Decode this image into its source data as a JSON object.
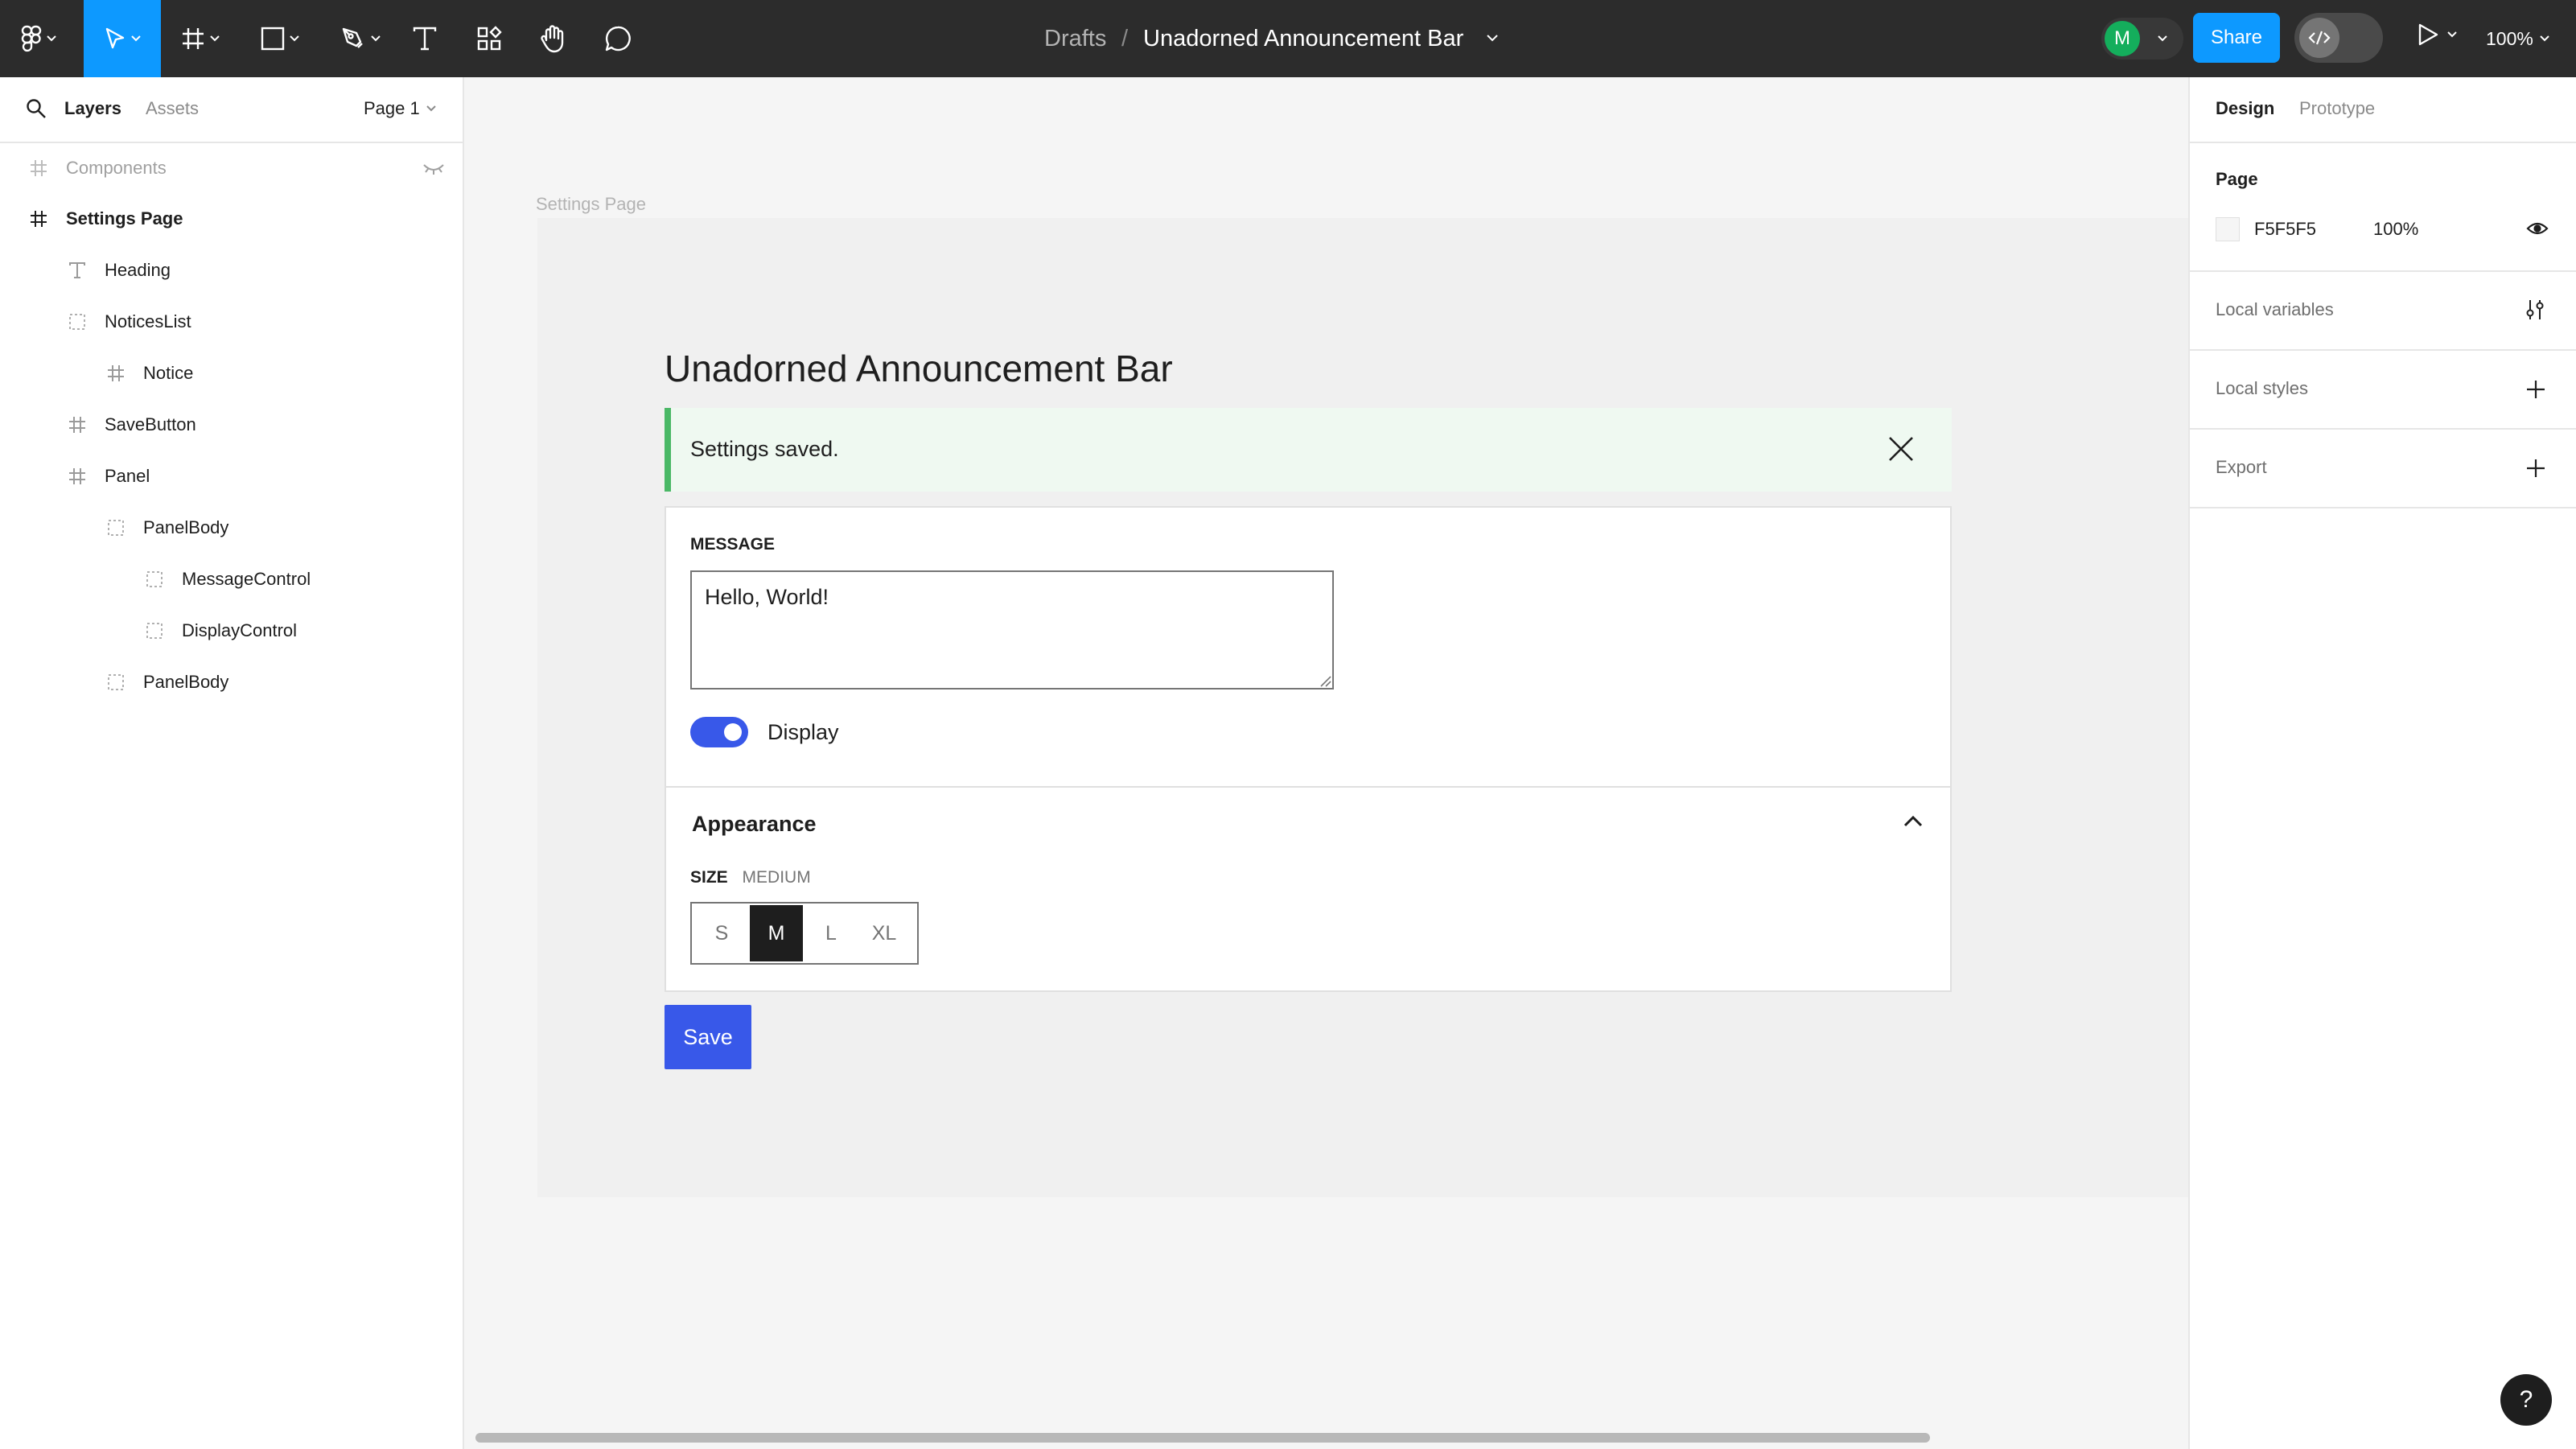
{
  "toolbar": {
    "breadcrumb_parent": "Drafts",
    "breadcrumb_separator": "/",
    "file_name": "Unadorned Announcement Bar",
    "avatar_initial": "M",
    "share_label": "Share",
    "zoom": "100%",
    "tools": [
      "main-menu-icon",
      "move-icon",
      "frame-icon",
      "shape-icon",
      "pen-icon",
      "text-icon",
      "resources-icon",
      "hand-icon",
      "comment-icon"
    ]
  },
  "left_panel": {
    "tab_layers": "Layers",
    "tab_assets": "Assets",
    "page_selector": "Page 1",
    "layers": [
      {
        "label": "Components",
        "icon": "frame-icon",
        "muted": true
      },
      {
        "label": "Settings Page",
        "icon": "frame-icon",
        "bold": true
      },
      {
        "label": "Heading",
        "icon": "text-icon"
      },
      {
        "label": "NoticesList",
        "icon": "group-icon"
      },
      {
        "label": "Notice",
        "icon": "frame-icon"
      },
      {
        "label": "SaveButton",
        "icon": "frame-icon"
      },
      {
        "label": "Panel",
        "icon": "frame-icon"
      },
      {
        "label": "PanelBody",
        "icon": "group-icon"
      },
      {
        "label": "MessageControl",
        "icon": "group-icon"
      },
      {
        "label": "DisplayControl",
        "icon": "group-icon"
      },
      {
        "label": "PanelBody",
        "icon": "group-icon"
      }
    ]
  },
  "right_panel": {
    "tab_design": "Design",
    "tab_prototype": "Prototype",
    "page_heading": "Page",
    "page_color": "F5F5F5",
    "page_opacity": "100%",
    "local_variables": "Local variables",
    "local_styles": "Local styles",
    "export": "Export"
  },
  "canvas": {
    "frame_label": "Settings Page",
    "heading": "Unadorned Announcement Bar",
    "notice_text": "Settings saved.",
    "message_label": "MESSAGE",
    "message_value": "Hello, World!",
    "display_label": "Display",
    "display_on": true,
    "appearance_title": "Appearance",
    "size_label": "SIZE",
    "size_value": "MEDIUM",
    "size_options": [
      "S",
      "M",
      "L",
      "XL"
    ],
    "size_selected": "M",
    "save_label": "Save"
  },
  "help_label": "?",
  "colors": {
    "toolbar_bg": "#2c2c2c",
    "active_tool": "#0d99ff",
    "share_button": "#0d99ff",
    "avatar": "#14ae5c",
    "notice_border": "#4ab866",
    "notice_bg": "#eff9f1",
    "primary": "#3858e9"
  }
}
